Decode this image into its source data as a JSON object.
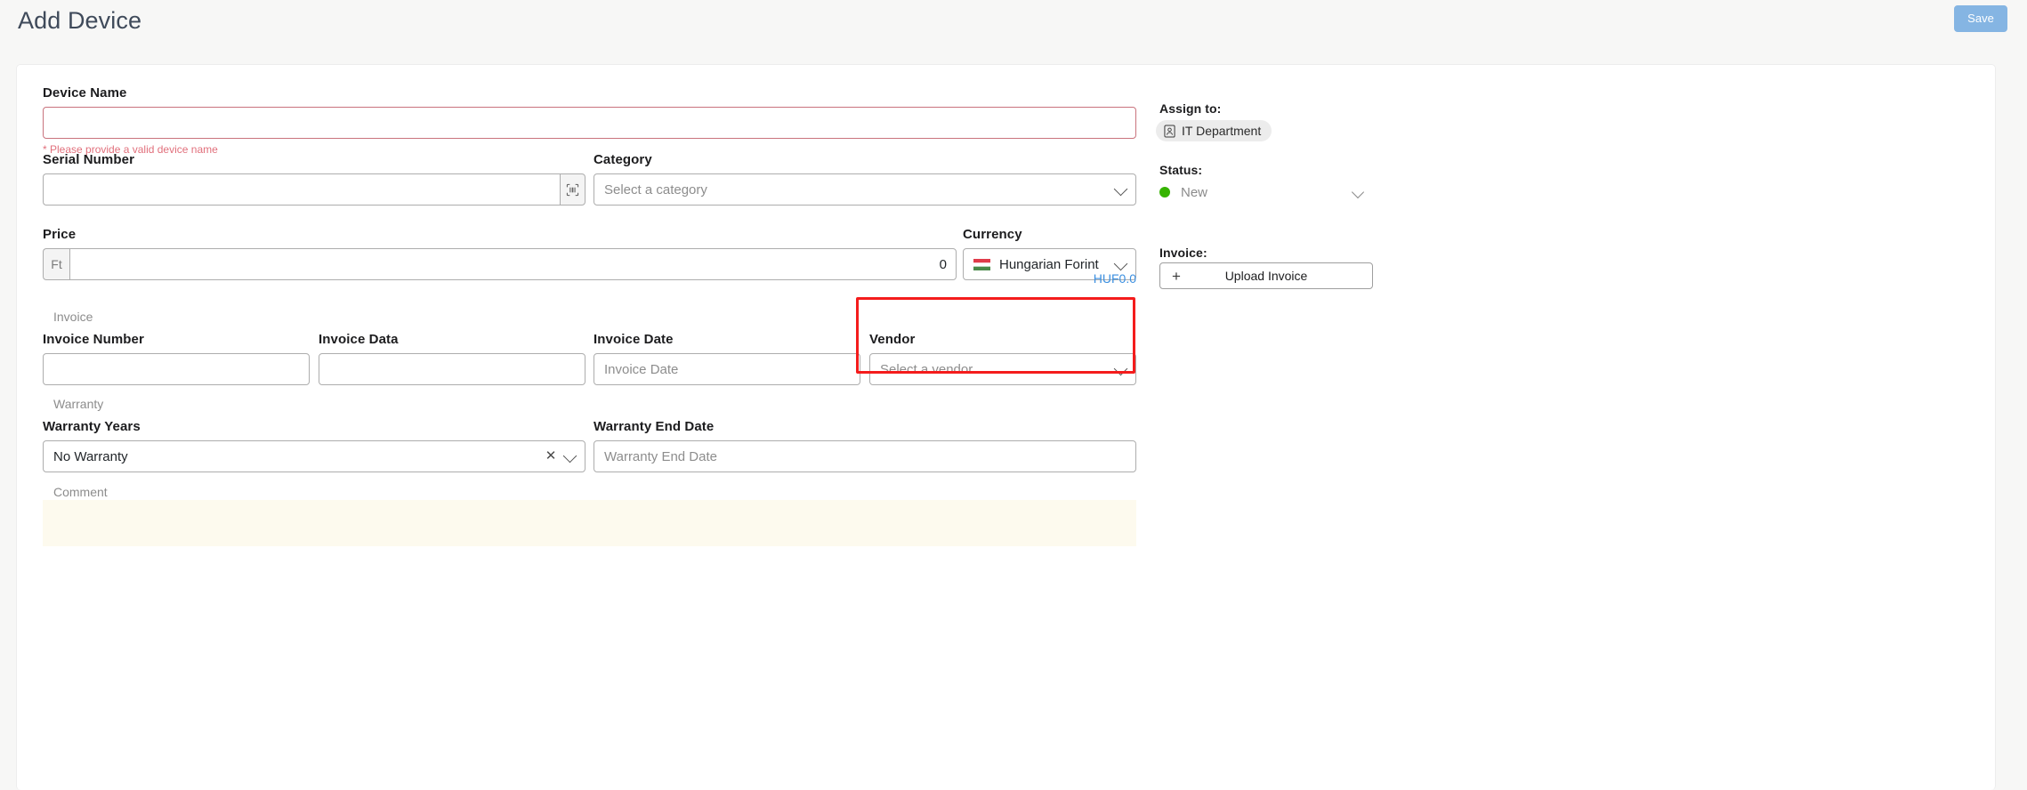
{
  "header": {
    "title": "Add Device",
    "save_label": "Save"
  },
  "form": {
    "device_name": {
      "label": "Device Name",
      "value": "",
      "error": "* Please provide a valid device name"
    },
    "serial_number": {
      "label": "Serial Number",
      "value": "",
      "scan_icon": "barcode-scan-icon"
    },
    "category": {
      "label": "Category",
      "placeholder": "Select a category",
      "value": ""
    },
    "price": {
      "label": "Price",
      "prefix": "Ft",
      "value": "0"
    },
    "currency": {
      "label": "Currency",
      "value": "Hungarian Forint",
      "flag": "hungary-flag-icon"
    },
    "total": "HUF0.0"
  },
  "invoice_section": {
    "section_label": "Invoice",
    "invoice_number": {
      "label": "Invoice Number",
      "value": ""
    },
    "invoice_data": {
      "label": "Invoice Data",
      "value": ""
    },
    "invoice_date": {
      "label": "Invoice Date",
      "placeholder": "Invoice Date",
      "value": ""
    },
    "vendor": {
      "label": "Vendor",
      "placeholder": "Select a vendor",
      "value": ""
    }
  },
  "warranty_section": {
    "section_label": "Warranty",
    "warranty_years": {
      "label": "Warranty Years",
      "value": "No Warranty"
    },
    "warranty_end_date": {
      "label": "Warranty End Date",
      "placeholder": "Warranty End Date",
      "value": ""
    }
  },
  "comment_section": {
    "label": "Comment",
    "value": "",
    "placeholder": ""
  },
  "sidebar": {
    "assign_to": {
      "label": "Assign to:",
      "chip_label": "IT Department",
      "chip_icon": "id-badge-icon"
    },
    "status": {
      "label": "Status:",
      "value": "New",
      "dot_color": "#36b300"
    },
    "invoice": {
      "label": "Invoice:",
      "upload_label": "Upload Invoice"
    }
  },
  "colors": {
    "accent_blue": "#3b8fe0",
    "save_button": "#85b5e3",
    "error_red": "#e1707c",
    "annotation_red": "#f41c1c",
    "status_green": "#36b300",
    "comment_bg": "#fdfaee"
  }
}
